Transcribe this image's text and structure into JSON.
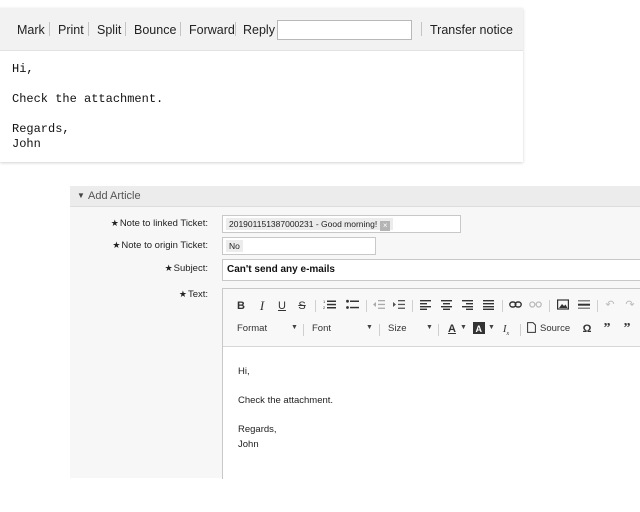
{
  "article_actions": {
    "items": [
      "Mark",
      "Print",
      "Split",
      "Bounce",
      "Forward",
      "Reply"
    ],
    "reply_input_value": "",
    "transfer_notice": "Transfer notice"
  },
  "article_body": {
    "lines": [
      "Hi,",
      "",
      "Check the attachment.",
      "",
      "Regards,",
      "John"
    ]
  },
  "add_article": {
    "title": "Add Article",
    "fields": {
      "note_linked": {
        "label": "Note to linked Ticket:",
        "value": "201901151387000231 - Good morning!"
      },
      "note_origin": {
        "label": "Note to origin Ticket:",
        "value": "No"
      },
      "subject": {
        "label": "Subject:",
        "value": "Can't send any e-mails"
      },
      "text": {
        "label": "Text:"
      }
    },
    "editor": {
      "format_label": "Format",
      "font_label": "Font",
      "size_label": "Size",
      "source_label": "Source",
      "body_lines": [
        "Hi,",
        "Check the attachment.",
        "Regards,",
        "John"
      ]
    }
  },
  "icons": {
    "required": "asterisk-icon",
    "toggle": "triangle-down-icon",
    "remove": "close-icon"
  }
}
